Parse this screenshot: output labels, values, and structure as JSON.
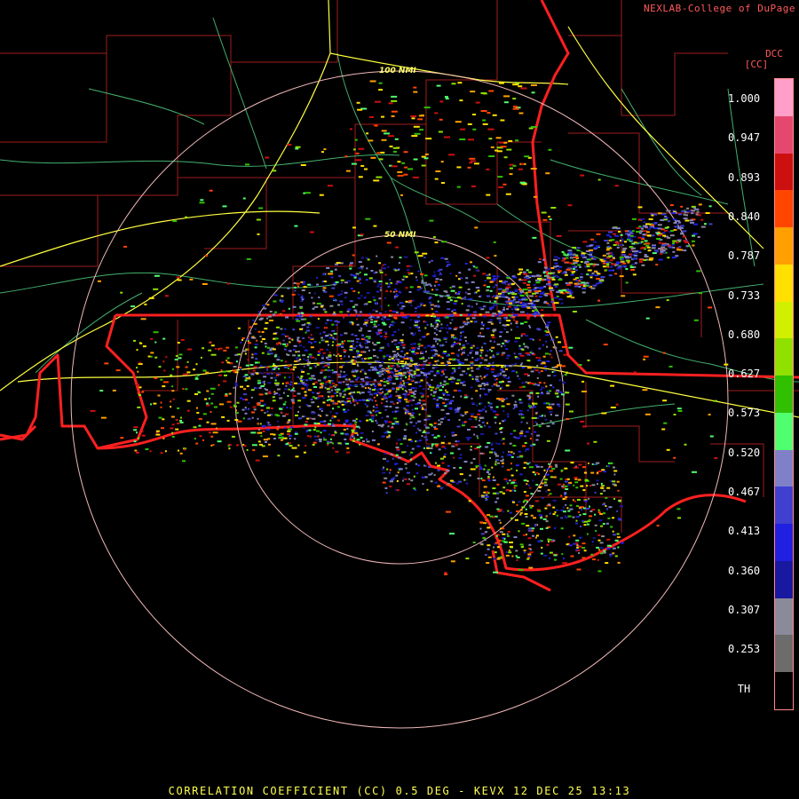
{
  "header": {
    "credit": "NEXLAB-College of DuPage",
    "product_code": "DCC",
    "units": "[CC]"
  },
  "legend": {
    "ticks": [
      "1.000",
      "0.947",
      "0.893",
      "0.840",
      "0.787",
      "0.733",
      "0.680",
      "0.627",
      "0.573",
      "0.520",
      "0.467",
      "0.413",
      "0.360",
      "0.307",
      "0.253",
      "TH"
    ],
    "colors": [
      "#ff9ec8",
      "#e5486e",
      "#cc1010",
      "#ff4500",
      "#ffa000",
      "#ffe000",
      "#d0f000",
      "#90e000",
      "#30c000",
      "#50ff70",
      "#8080c8",
      "#4040d0",
      "#2020e0",
      "#1818a0",
      "#8a8a9a",
      "#6c6c6c",
      "#000000"
    ]
  },
  "map": {
    "range_rings": [
      {
        "label": "50 NMI"
      },
      {
        "label": "100 NMI"
      }
    ],
    "colors": {
      "state_border": "#ff2020",
      "county_line": "#b02020",
      "highway": "#ffff40",
      "road": "#50d080",
      "ring": "#f0b8b8"
    }
  },
  "footer": {
    "caption": "CORRELATION COEFFICIENT (CC) 0.5 DEG - KEVX 12 DEC 25 13:13"
  }
}
